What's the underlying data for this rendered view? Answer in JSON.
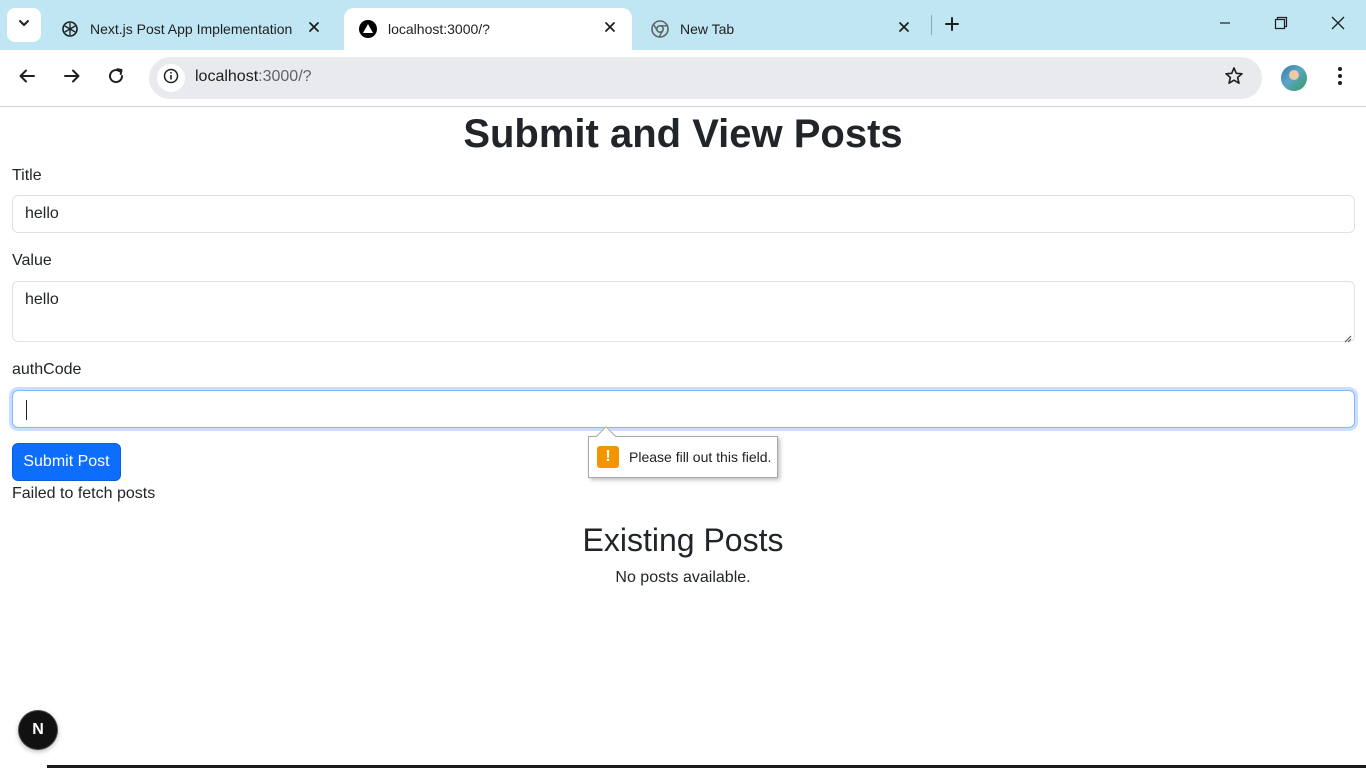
{
  "browser": {
    "tabs": [
      {
        "title": "Next.js Post App Implementation",
        "icon": "openai-icon",
        "active": false
      },
      {
        "title": "localhost:3000/?",
        "icon": "nextjs-triangle-icon",
        "active": true
      },
      {
        "title": "New Tab",
        "icon": "chrome-icon",
        "active": false
      }
    ],
    "address_bar": {
      "host": "localhost",
      "rest": ":3000/?"
    }
  },
  "page": {
    "title": "Submit and View Posts",
    "form": {
      "title_label": "Title",
      "title_value": "hello",
      "value_label": "Value",
      "value_value": "hello",
      "auth_label": "authCode",
      "auth_value": "",
      "submit_label": "Submit Post"
    },
    "validation_message": "Please fill out this field.",
    "error_text": "Failed to fetch posts",
    "posts_section_title": "Existing Posts",
    "empty_text": "No posts available.",
    "dev_indicator": "N"
  },
  "colors": {
    "tabstrip": "#bfe6f2",
    "primary": "#0d6efd",
    "warning": "#f29500"
  }
}
